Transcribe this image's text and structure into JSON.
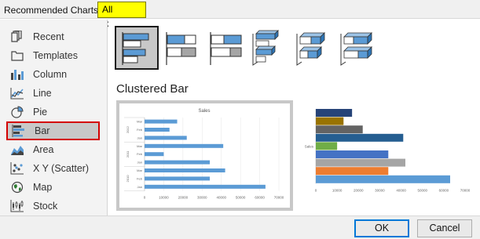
{
  "tabs": [
    {
      "label": "Recommended Charts"
    },
    {
      "label": "All Charts"
    }
  ],
  "sidebar": {
    "items": [
      {
        "label": "Recent",
        "icon": "recent-icon"
      },
      {
        "label": "Templates",
        "icon": "templates-icon"
      },
      {
        "label": "Column",
        "icon": "column-chart-icon"
      },
      {
        "label": "Line",
        "icon": "line-chart-icon"
      },
      {
        "label": "Pie",
        "icon": "pie-chart-icon"
      },
      {
        "label": "Bar",
        "icon": "bar-chart-icon",
        "selected": true
      },
      {
        "label": "Area",
        "icon": "area-chart-icon"
      },
      {
        "label": "X Y (Scatter)",
        "icon": "scatter-chart-icon"
      },
      {
        "label": "Map",
        "icon": "map-icon"
      },
      {
        "label": "Stock",
        "icon": "stock-chart-icon"
      }
    ]
  },
  "subtypes": [
    {
      "name": "clustered-bar",
      "selected": true
    },
    {
      "name": "stacked-bar"
    },
    {
      "name": "100-stacked-bar"
    },
    {
      "name": "3d-clustered-bar"
    },
    {
      "name": "3d-stacked-bar"
    },
    {
      "name": "3d-100-stacked-bar"
    }
  ],
  "main": {
    "subtitle": "Clustered Bar"
  },
  "colors": {
    "bar_blue": "#5b9bd5",
    "selection_red": "#d40000",
    "tab_highlight": "#ffff00"
  },
  "chart_data": [
    {
      "type": "bar",
      "title": "Sales",
      "categories": [
        "Jan",
        "Feb",
        "Mar",
        "Jan",
        "Feb",
        "Mar",
        "Jan",
        "Feb",
        "Mar"
      ],
      "groups": [
        "2010",
        "2011",
        "2012"
      ],
      "values": [
        63000,
        34000,
        42000,
        34000,
        10000,
        41000,
        22000,
        13000,
        17000
      ],
      "xlim": [
        0,
        70000
      ],
      "xticks": [
        "0",
        "10000",
        "20000",
        "30000",
        "40000",
        "50000",
        "60000",
        "70000"
      ]
    },
    {
      "type": "bar",
      "category": "Sales",
      "values": [
        63000,
        34000,
        42000,
        34000,
        10000,
        41000,
        22000,
        13000,
        17000
      ],
      "colors": [
        "#5b9bd5",
        "#ed7d31",
        "#a5a5a5",
        "#4472c4",
        "#70ad47",
        "#255e91",
        "#636363",
        "#997300",
        "#264478"
      ],
      "xlim": [
        0,
        70000
      ],
      "xticks": [
        "0",
        "10000",
        "20000",
        "30000",
        "40000",
        "50000",
        "60000",
        "70000"
      ]
    }
  ],
  "footer": {
    "ok_label": "OK",
    "cancel_label": "Cancel"
  }
}
